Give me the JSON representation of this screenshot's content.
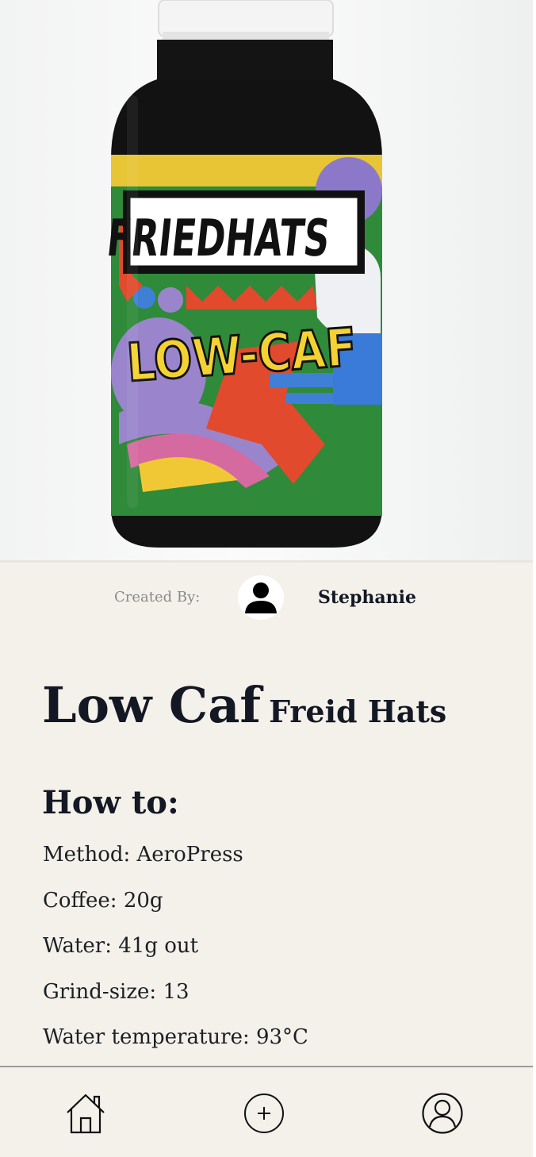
{
  "product_image": {
    "alt": "Friedhats Low-Caf coffee jar",
    "label_brand": "FRIEDHATS",
    "label_product": "LOW-CAF"
  },
  "creator": {
    "label": "Created By:",
    "name": "Stephanie",
    "avatar_icon": "user-silhouette-icon"
  },
  "coffee": {
    "name": "Low Caf",
    "roaster": "Freid Hats"
  },
  "how_to": {
    "heading": "How to:",
    "details": [
      "Method: AeroPress",
      "Coffee: 20g",
      "Water: 41g out",
      "Grind-size: 13",
      "Water temperature: 93°C"
    ]
  },
  "bottom_nav": {
    "items": [
      {
        "icon": "home-icon"
      },
      {
        "icon": "plus-circle-icon"
      },
      {
        "icon": "profile-icon"
      }
    ]
  },
  "colors": {
    "background": "#f3f1ea",
    "text": "#141824",
    "muted": "#8a8a8a",
    "divider": "#9c9c9c"
  }
}
